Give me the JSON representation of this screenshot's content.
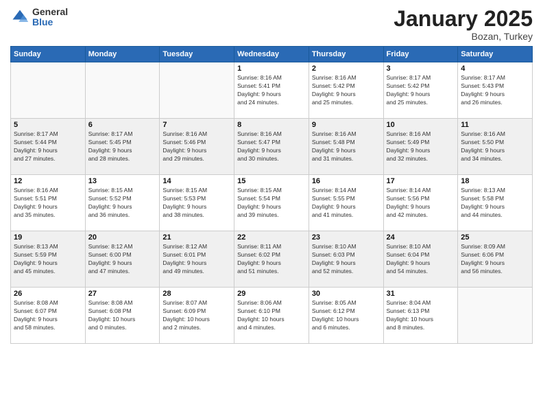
{
  "logo": {
    "general": "General",
    "blue": "Blue"
  },
  "title": "January 2025",
  "location": "Bozan, Turkey",
  "weekdays": [
    "Sunday",
    "Monday",
    "Tuesday",
    "Wednesday",
    "Thursday",
    "Friday",
    "Saturday"
  ],
  "weeks": [
    [
      {
        "day": "",
        "info": ""
      },
      {
        "day": "",
        "info": ""
      },
      {
        "day": "",
        "info": ""
      },
      {
        "day": "1",
        "info": "Sunrise: 8:16 AM\nSunset: 5:41 PM\nDaylight: 9 hours\nand 24 minutes."
      },
      {
        "day": "2",
        "info": "Sunrise: 8:16 AM\nSunset: 5:42 PM\nDaylight: 9 hours\nand 25 minutes."
      },
      {
        "day": "3",
        "info": "Sunrise: 8:17 AM\nSunset: 5:42 PM\nDaylight: 9 hours\nand 25 minutes."
      },
      {
        "day": "4",
        "info": "Sunrise: 8:17 AM\nSunset: 5:43 PM\nDaylight: 9 hours\nand 26 minutes."
      }
    ],
    [
      {
        "day": "5",
        "info": "Sunrise: 8:17 AM\nSunset: 5:44 PM\nDaylight: 9 hours\nand 27 minutes."
      },
      {
        "day": "6",
        "info": "Sunrise: 8:17 AM\nSunset: 5:45 PM\nDaylight: 9 hours\nand 28 minutes."
      },
      {
        "day": "7",
        "info": "Sunrise: 8:16 AM\nSunset: 5:46 PM\nDaylight: 9 hours\nand 29 minutes."
      },
      {
        "day": "8",
        "info": "Sunrise: 8:16 AM\nSunset: 5:47 PM\nDaylight: 9 hours\nand 30 minutes."
      },
      {
        "day": "9",
        "info": "Sunrise: 8:16 AM\nSunset: 5:48 PM\nDaylight: 9 hours\nand 31 minutes."
      },
      {
        "day": "10",
        "info": "Sunrise: 8:16 AM\nSunset: 5:49 PM\nDaylight: 9 hours\nand 32 minutes."
      },
      {
        "day": "11",
        "info": "Sunrise: 8:16 AM\nSunset: 5:50 PM\nDaylight: 9 hours\nand 34 minutes."
      }
    ],
    [
      {
        "day": "12",
        "info": "Sunrise: 8:16 AM\nSunset: 5:51 PM\nDaylight: 9 hours\nand 35 minutes."
      },
      {
        "day": "13",
        "info": "Sunrise: 8:15 AM\nSunset: 5:52 PM\nDaylight: 9 hours\nand 36 minutes."
      },
      {
        "day": "14",
        "info": "Sunrise: 8:15 AM\nSunset: 5:53 PM\nDaylight: 9 hours\nand 38 minutes."
      },
      {
        "day": "15",
        "info": "Sunrise: 8:15 AM\nSunset: 5:54 PM\nDaylight: 9 hours\nand 39 minutes."
      },
      {
        "day": "16",
        "info": "Sunrise: 8:14 AM\nSunset: 5:55 PM\nDaylight: 9 hours\nand 41 minutes."
      },
      {
        "day": "17",
        "info": "Sunrise: 8:14 AM\nSunset: 5:56 PM\nDaylight: 9 hours\nand 42 minutes."
      },
      {
        "day": "18",
        "info": "Sunrise: 8:13 AM\nSunset: 5:58 PM\nDaylight: 9 hours\nand 44 minutes."
      }
    ],
    [
      {
        "day": "19",
        "info": "Sunrise: 8:13 AM\nSunset: 5:59 PM\nDaylight: 9 hours\nand 45 minutes."
      },
      {
        "day": "20",
        "info": "Sunrise: 8:12 AM\nSunset: 6:00 PM\nDaylight: 9 hours\nand 47 minutes."
      },
      {
        "day": "21",
        "info": "Sunrise: 8:12 AM\nSunset: 6:01 PM\nDaylight: 9 hours\nand 49 minutes."
      },
      {
        "day": "22",
        "info": "Sunrise: 8:11 AM\nSunset: 6:02 PM\nDaylight: 9 hours\nand 51 minutes."
      },
      {
        "day": "23",
        "info": "Sunrise: 8:10 AM\nSunset: 6:03 PM\nDaylight: 9 hours\nand 52 minutes."
      },
      {
        "day": "24",
        "info": "Sunrise: 8:10 AM\nSunset: 6:04 PM\nDaylight: 9 hours\nand 54 minutes."
      },
      {
        "day": "25",
        "info": "Sunrise: 8:09 AM\nSunset: 6:06 PM\nDaylight: 9 hours\nand 56 minutes."
      }
    ],
    [
      {
        "day": "26",
        "info": "Sunrise: 8:08 AM\nSunset: 6:07 PM\nDaylight: 9 hours\nand 58 minutes."
      },
      {
        "day": "27",
        "info": "Sunrise: 8:08 AM\nSunset: 6:08 PM\nDaylight: 10 hours\nand 0 minutes."
      },
      {
        "day": "28",
        "info": "Sunrise: 8:07 AM\nSunset: 6:09 PM\nDaylight: 10 hours\nand 2 minutes."
      },
      {
        "day": "29",
        "info": "Sunrise: 8:06 AM\nSunset: 6:10 PM\nDaylight: 10 hours\nand 4 minutes."
      },
      {
        "day": "30",
        "info": "Sunrise: 8:05 AM\nSunset: 6:12 PM\nDaylight: 10 hours\nand 6 minutes."
      },
      {
        "day": "31",
        "info": "Sunrise: 8:04 AM\nSunset: 6:13 PM\nDaylight: 10 hours\nand 8 minutes."
      },
      {
        "day": "",
        "info": ""
      }
    ]
  ]
}
